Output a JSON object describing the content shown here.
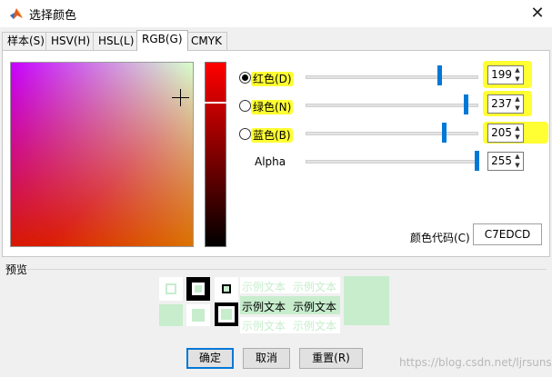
{
  "window": {
    "title": "选择颜色",
    "app_icon": "matlab-icon",
    "close_glyph": "✕"
  },
  "tabs": [
    {
      "label": "样本(S)",
      "active": false
    },
    {
      "label": "HSV(H)",
      "active": false
    },
    {
      "label": "HSL(L)",
      "active": false
    },
    {
      "label": "RGB(G)",
      "active": true
    },
    {
      "label": "CMYK",
      "active": false
    }
  ],
  "channels": [
    {
      "label": "红色(D)",
      "value": "199",
      "selected": true,
      "fraction": 0.78
    },
    {
      "label": "绿色(N)",
      "value": "237",
      "selected": false,
      "fraction": 0.93
    },
    {
      "label": "蓝色(B)",
      "value": "205",
      "selected": false,
      "fraction": 0.8
    }
  ],
  "alpha": {
    "label": "Alpha",
    "value": "255",
    "fraction": 1.0
  },
  "hex": {
    "label": "颜色代码(C)",
    "value": "C7EDCD"
  },
  "preview": {
    "label": "预览",
    "sample_text": "示例文本",
    "color": "#c7edcd"
  },
  "buttons": {
    "ok": "确定",
    "cancel": "取消",
    "reset": "重置(R)"
  },
  "watermark": "https://blog.csdn.net/ljrsunshine",
  "colors": {
    "accent": "#0078d7",
    "highlight": "#ffff33",
    "selected_color": "#c7edcd"
  }
}
